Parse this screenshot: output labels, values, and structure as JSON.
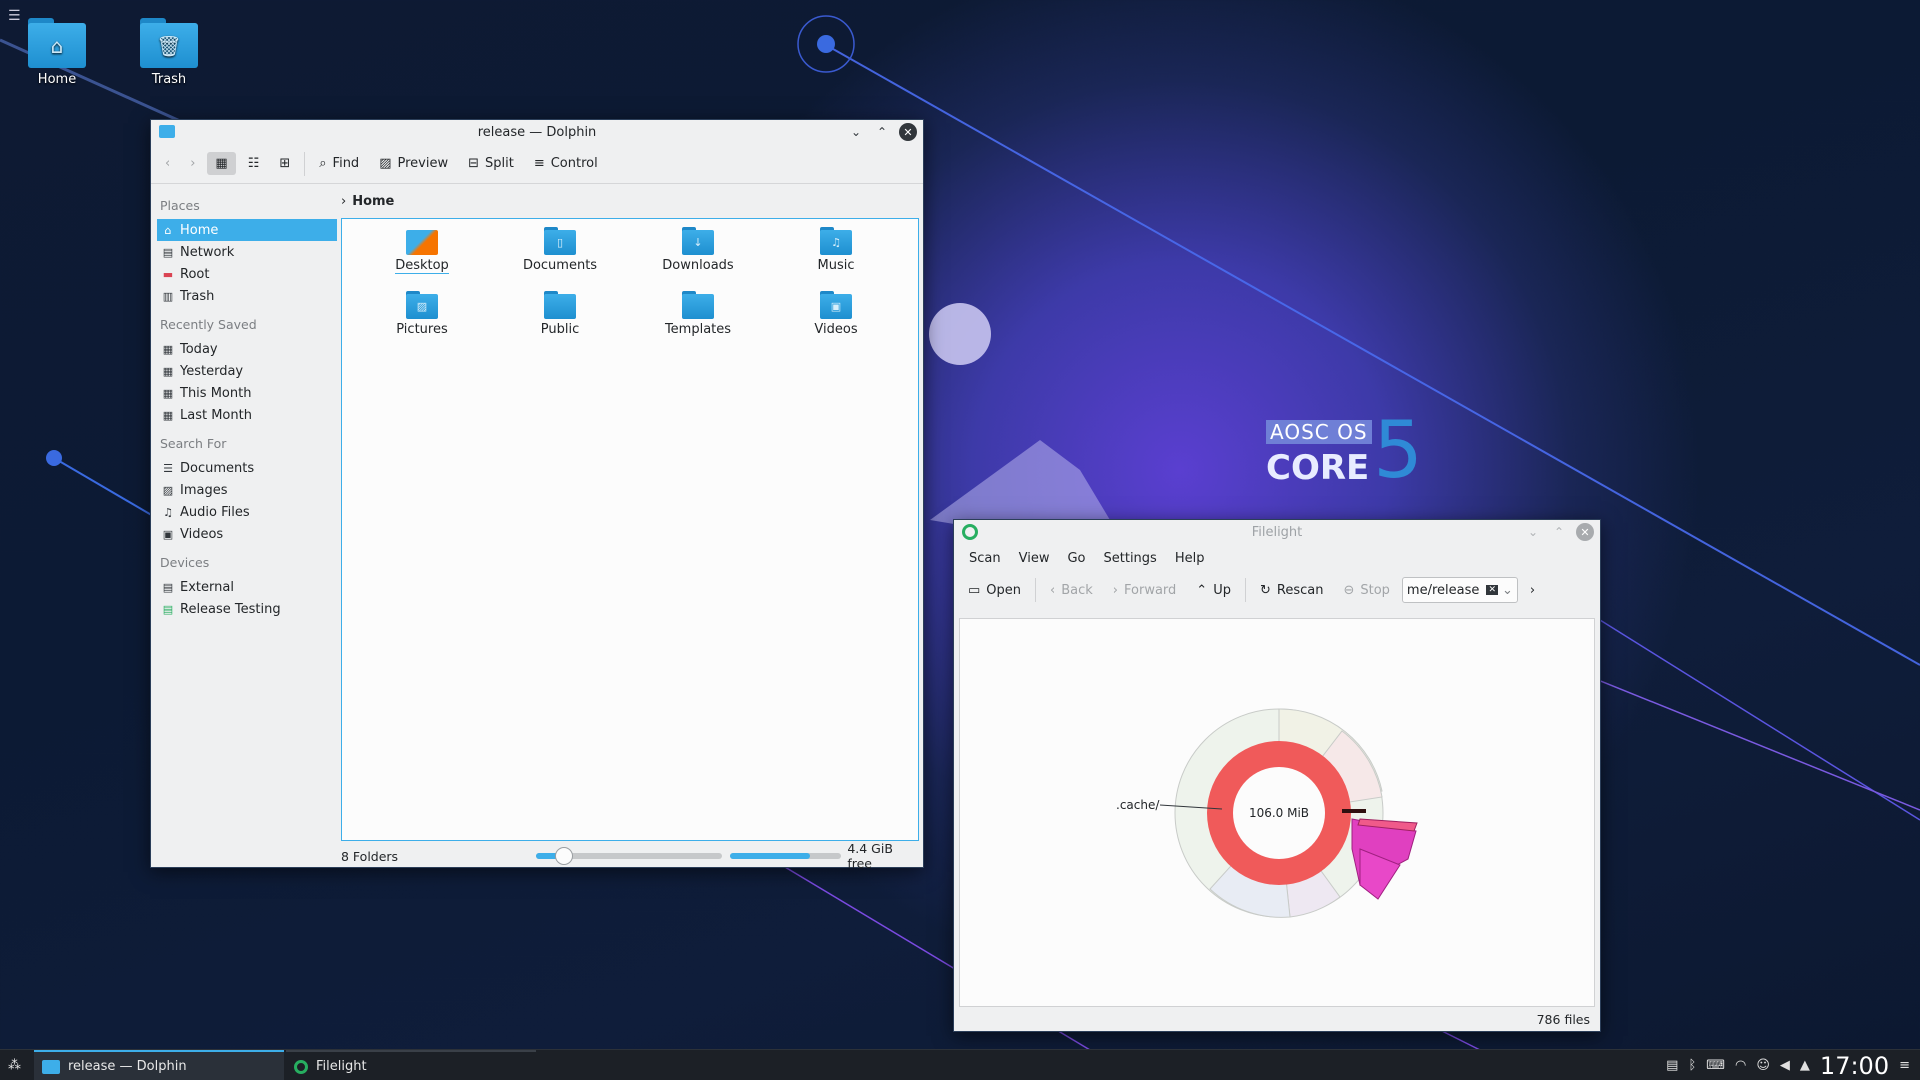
{
  "desktop": {
    "icons": [
      {
        "label": "Home",
        "icon": "home-icon"
      },
      {
        "label": "Trash",
        "icon": "trash-icon"
      }
    ],
    "branding": {
      "line1": "AOSC OS",
      "line2": "CORE",
      "digit": "5"
    }
  },
  "dolphin": {
    "title": "release — Dolphin",
    "toolbar": {
      "find": "Find",
      "preview": "Preview",
      "split": "Split",
      "control": "Control"
    },
    "sidebar": {
      "places_header": "Places",
      "places": [
        "Home",
        "Network",
        "Root",
        "Trash"
      ],
      "recent_header": "Recently Saved",
      "recent": [
        "Today",
        "Yesterday",
        "This Month",
        "Last Month"
      ],
      "search_header": "Search For",
      "search": [
        "Documents",
        "Images",
        "Audio Files",
        "Videos"
      ],
      "devices_header": "Devices",
      "devices": [
        "External",
        "Release Testing"
      ]
    },
    "breadcrumb": "Home",
    "folders": [
      "Desktop",
      "Documents",
      "Downloads",
      "Music",
      "Pictures",
      "Public",
      "Templates",
      "Videos"
    ],
    "status": {
      "count": "8 Folders",
      "free": "4.4 GiB free",
      "zoom_fraction": 0.15,
      "used_fraction": 0.72
    }
  },
  "filelight": {
    "title": "Filelight",
    "menu": [
      "Scan",
      "View",
      "Go",
      "Settings",
      "Help"
    ],
    "toolbar": {
      "open": "Open",
      "back": "Back",
      "forward": "Forward",
      "up": "Up",
      "rescan": "Rescan",
      "stop": "Stop"
    },
    "path": "me/release",
    "center_label": "106.0 MiB",
    "segment_label": ".cache/",
    "status": "786 files"
  },
  "taskbar": {
    "tasks": [
      "release — Dolphin",
      "Filelight"
    ],
    "clock": "17:00"
  },
  "colors": {
    "accent": "#3daee9",
    "ring": "#f05a5a",
    "magenta": "#e040c0"
  }
}
